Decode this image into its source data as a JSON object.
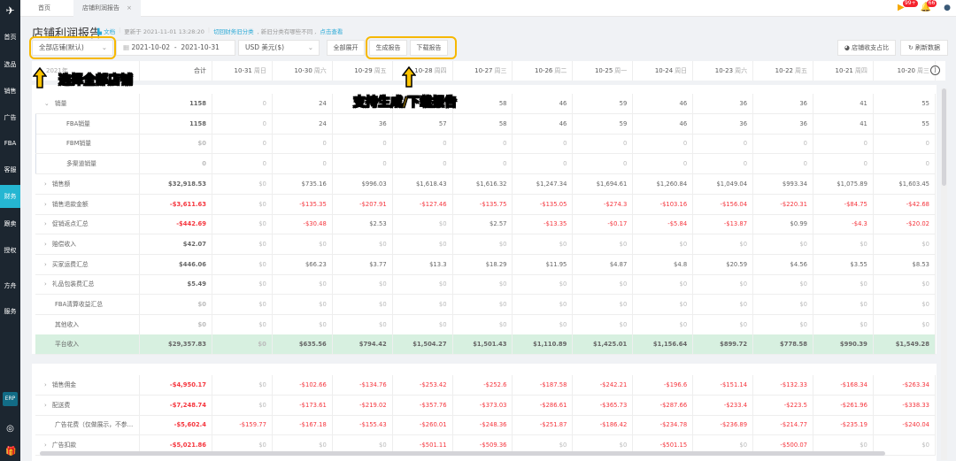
{
  "sidebar": {
    "items": [
      "首页",
      "选品",
      "销售",
      "广告",
      "FBA",
      "客服",
      "财务",
      "跟卖",
      "授权",
      "方舟",
      "服务"
    ],
    "active": "财务",
    "erp": "ERP"
  },
  "tabs": [
    {
      "label": "首页"
    },
    {
      "label": "店铺利润报告"
    }
  ],
  "notifications": {
    "flag_count": "99+",
    "bell_count": "66"
  },
  "page": {
    "title": "店铺利润报告",
    "doc_link": "文档",
    "updated": "更新于 2021-11-01 13:28:20",
    "switch_link": "切回财务旧分类",
    "note": ", 新旧分类有哪些不同 ,",
    "view_link": "点击查看"
  },
  "filters": {
    "store": "全部店铺(默认)",
    "date_start": "2021-10-02",
    "date_sep": "-",
    "date_end": "2021-10-31",
    "currency": "USD  美元($)",
    "expand_all": "全部展开",
    "generate": "生成报告",
    "download": "下载报告",
    "ratio": "店铺收支占比",
    "refresh": "刷新数据"
  },
  "table": {
    "first_header": "2021年",
    "total_header": "合计",
    "columns": [
      {
        "date": "10-31",
        "wd": "周日"
      },
      {
        "date": "10-30",
        "wd": "周六"
      },
      {
        "date": "10-29",
        "wd": "周五"
      },
      {
        "date": "10-28",
        "wd": "周四"
      },
      {
        "date": "10-27",
        "wd": "周三"
      },
      {
        "date": "10-26",
        "wd": "周二"
      },
      {
        "date": "10-25",
        "wd": "周一"
      },
      {
        "date": "10-24",
        "wd": "周日"
      },
      {
        "date": "10-23",
        "wd": "周六"
      },
      {
        "date": "10-22",
        "wd": "周五"
      },
      {
        "date": "10-21",
        "wd": "周四"
      },
      {
        "date": "10-20",
        "wd": "周三"
      }
    ],
    "rows": [
      {
        "label": "销量",
        "expand": "down",
        "indent": 0,
        "total": "1158",
        "values": [
          "0",
          "24",
          "36",
          "57",
          "58",
          "46",
          "59",
          "46",
          "36",
          "36",
          "41",
          "55"
        ]
      },
      {
        "label": "FBA销量",
        "indent": 1,
        "total": "1158",
        "values": [
          "0",
          "24",
          "36",
          "57",
          "58",
          "46",
          "59",
          "46",
          "36",
          "36",
          "41",
          "55"
        ]
      },
      {
        "label": "FBM销量",
        "indent": 1,
        "total": "$0",
        "values": [
          "0",
          "0",
          "0",
          "0",
          "0",
          "0",
          "0",
          "0",
          "0",
          "0",
          "0",
          "0"
        ]
      },
      {
        "label": "多渠道销量",
        "indent": 1,
        "total": "0",
        "values": [
          "0",
          "0",
          "0",
          "0",
          "0",
          "0",
          "0",
          "0",
          "0",
          "0",
          "0",
          "0"
        ]
      },
      {
        "label": "销售额",
        "expand": "right",
        "indent": 0,
        "total": "$32,918.53",
        "values": [
          "$0",
          "$735.16",
          "$996.03",
          "$1,618.43",
          "$1,616.32",
          "$1,247.34",
          "$1,694.61",
          "$1,260.84",
          "$1,049.04",
          "$993.34",
          "$1,075.89",
          "$1,603.45"
        ]
      },
      {
        "label": "销售退款金额",
        "expand": "right",
        "indent": 0,
        "total": "-$3,611.63",
        "values": [
          "$0",
          "-$135.35",
          "-$207.91",
          "-$127.46",
          "-$135.75",
          "-$135.05",
          "-$274.3",
          "-$103.16",
          "-$156.04",
          "-$220.31",
          "-$84.75",
          "-$42.68"
        ]
      },
      {
        "label": "促销返点汇总",
        "expand": "right",
        "indent": 0,
        "total": "-$442.69",
        "values": [
          "$0",
          "-$30.48",
          "$2.53",
          "$0",
          "$2.57",
          "-$13.35",
          "-$0.17",
          "-$5.84",
          "-$13.87",
          "$0.99",
          "-$4.3",
          "-$20.02"
        ]
      },
      {
        "label": "赔偿收入",
        "expand": "right",
        "indent": 0,
        "total": "$42.07",
        "values": [
          "$0",
          "$0",
          "$0",
          "$0",
          "$0",
          "$0",
          "$0",
          "$0",
          "$0",
          "$0",
          "$0",
          "$0"
        ]
      },
      {
        "label": "买家运费汇总",
        "expand": "right",
        "indent": 0,
        "total": "$446.06",
        "values": [
          "$0",
          "$66.23",
          "$3.77",
          "$13.3",
          "$18.29",
          "$11.95",
          "$4.87",
          "$4.8",
          "$20.59",
          "$4.56",
          "$3.55",
          "$8.53"
        ]
      },
      {
        "label": "礼品包装费汇总",
        "expand": "right",
        "indent": 0,
        "total": "$5.49",
        "values": [
          "$0",
          "$0",
          "$0",
          "$0",
          "$0",
          "$0",
          "$0",
          "$0",
          "$0",
          "$0",
          "$0",
          "$0"
        ]
      },
      {
        "label": "FBA清算收益汇总",
        "indent": 0,
        "total": "$0",
        "values": [
          "$0",
          "$0",
          "$0",
          "$0",
          "$0",
          "$0",
          "$0",
          "$0",
          "$0",
          "$0",
          "$0",
          "$0"
        ]
      },
      {
        "label": "其他收入",
        "indent": 0,
        "total": "$0",
        "values": [
          "$0",
          "$0",
          "$0",
          "$0",
          "$0",
          "$0",
          "$0",
          "$0",
          "$0",
          "$0",
          "$0",
          "$0"
        ]
      },
      {
        "label": "平台收入",
        "indent": 0,
        "summary": true,
        "total": "$29,357.83",
        "values": [
          "$0",
          "$635.56",
          "$794.42",
          "$1,504.27",
          "$1,501.43",
          "$1,110.89",
          "$1,425.01",
          "$1,156.64",
          "$899.72",
          "$778.58",
          "$990.39",
          "$1,549.28"
        ]
      }
    ],
    "rows2": [
      {
        "label": "销售佣金",
        "expand": "right",
        "indent": 0,
        "total": "-$4,950.17",
        "values": [
          "$0",
          "-$102.66",
          "-$134.76",
          "-$253.42",
          "-$252.6",
          "-$187.58",
          "-$242.21",
          "-$196.6",
          "-$151.14",
          "-$132.33",
          "-$168.34",
          "-$263.34"
        ]
      },
      {
        "label": "配送费",
        "expand": "right",
        "indent": 0,
        "total": "-$7,248.74",
        "values": [
          "$0",
          "-$173.61",
          "-$219.02",
          "-$357.76",
          "-$373.03",
          "-$286.61",
          "-$365.73",
          "-$287.66",
          "-$233.4",
          "-$223.5",
          "-$261.96",
          "-$338.33"
        ]
      },
      {
        "label": "广告花费（仅做展示，不参…",
        "indent": 0,
        "total": "-$5,602.4",
        "values": [
          "-$159.77",
          "-$167.18",
          "-$155.43",
          "-$260.01",
          "-$248.36",
          "-$251.87",
          "-$186.42",
          "-$234.78",
          "-$236.89",
          "-$214.77",
          "-$235.19",
          "-$240.04"
        ]
      },
      {
        "label": "广告扣款",
        "expand": "right",
        "indent": 0,
        "total": "-$5,021.86",
        "values": [
          "$0",
          "$0",
          "$0",
          "-$501.11",
          "-$509.36",
          "$0",
          "$0",
          "-$501.15",
          "$0",
          "-$500.07",
          "$0",
          "$0"
        ]
      }
    ]
  },
  "annotations": {
    "select_store": "选择全部店铺",
    "generate_download": "支持生成/下载报告"
  },
  "colors": {
    "accent": "#25b6d2",
    "negative": "#f5363e",
    "highlight": "#f6b800",
    "summary_bg": "#d7f0e0"
  }
}
